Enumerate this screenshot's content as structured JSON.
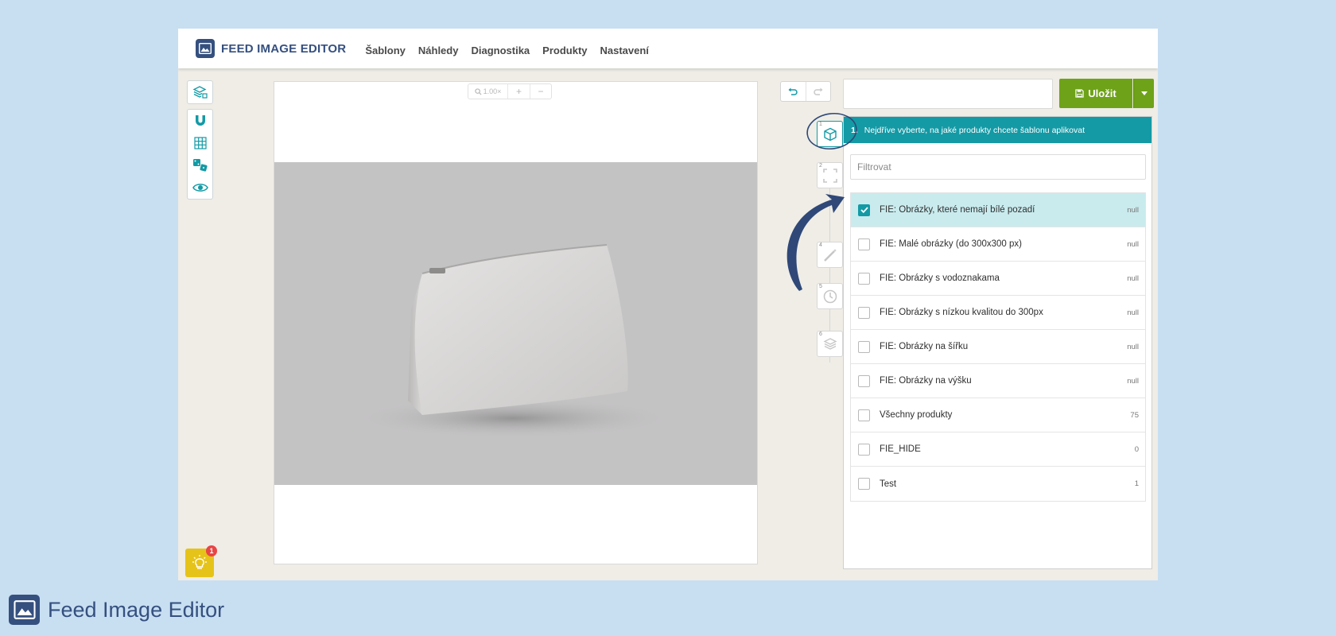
{
  "app": {
    "brand": "FEED IMAGE EDITOR",
    "menu": [
      "Šablony",
      "Náhledy",
      "Diagnostika",
      "Produkty",
      "Nastavení"
    ]
  },
  "toolbar": {
    "tools": [
      "layers-add-icon",
      "magnet-icon",
      "grid-icon",
      "dice-icon",
      "eye-icon"
    ]
  },
  "canvas": {
    "zoom_label": "1.00×",
    "zoom_in": "+",
    "zoom_out": "−"
  },
  "editor": {
    "name_value": "",
    "save_label": "Uložit"
  },
  "steps": [
    {
      "num": "1",
      "icon": "cube-icon",
      "active": true
    },
    {
      "num": "2",
      "icon": "crop-icon",
      "active": false
    },
    {
      "num": "4",
      "icon": "wand-icon",
      "active": false
    },
    {
      "num": "5",
      "icon": "clock-icon",
      "active": false
    },
    {
      "num": "6",
      "icon": "layers-icon",
      "active": false
    }
  ],
  "panel": {
    "step_number": "1.",
    "header": "Nejdříve vyberte, na jaké produkty chcete šablonu aplikovat",
    "filter_placeholder": "Filtrovat",
    "items": [
      {
        "label": "FIE: Obrázky, které nemají bílé pozadí",
        "count": "null",
        "checked": true
      },
      {
        "label": "FIE: Malé obrázky (do 300x300 px)",
        "count": "null",
        "checked": false
      },
      {
        "label": "FIE: Obrázky s vodoznakama",
        "count": "null",
        "checked": false
      },
      {
        "label": "FIE: Obrázky s nízkou kvalitou do 300px",
        "count": "null",
        "checked": false
      },
      {
        "label": "FIE: Obrázky na šířku",
        "count": "null",
        "checked": false
      },
      {
        "label": "FIE: Obrázky na výšku",
        "count": "null",
        "checked": false
      },
      {
        "label": "Všechny produkty",
        "count": "75",
        "checked": false
      },
      {
        "label": "FIE_HIDE",
        "count": "0",
        "checked": false
      },
      {
        "label": "Test",
        "count": "1",
        "checked": false
      }
    ]
  },
  "hint": {
    "badge": "1"
  },
  "footer": {
    "brand": "Feed Image Editor"
  },
  "colors": {
    "accent_teal": "#139aa5",
    "save_green": "#6ea219",
    "brand_navy": "#35507f",
    "page_background": "#c8dff2",
    "hint_yellow": "#e6c319"
  }
}
